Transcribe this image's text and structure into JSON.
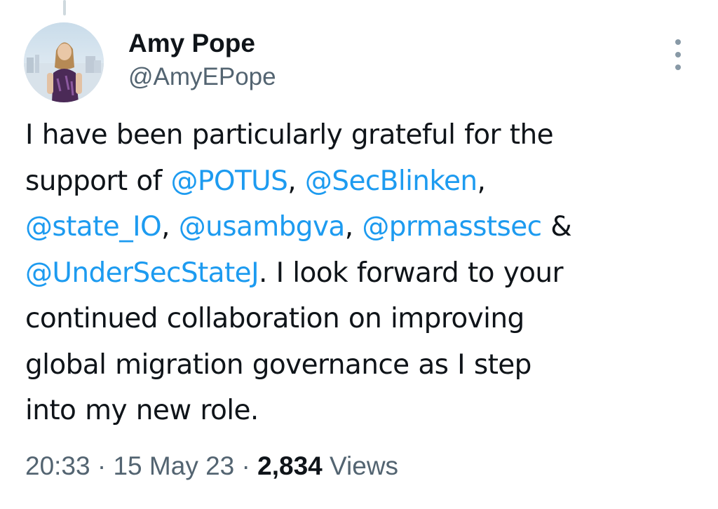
{
  "author": {
    "name": "Amy Pope",
    "handle": "@AmyEPope",
    "avatar_icon": "profile-photo"
  },
  "more_icon": "more-vertical-icon",
  "tweet": {
    "lines": [
      [
        {
          "text": "I have been particularly grateful for the",
          "type": "text"
        }
      ],
      [
        {
          "text": "support of ",
          "type": "text"
        },
        {
          "text": "@POTUS",
          "type": "mention"
        },
        {
          "text": ", ",
          "type": "text"
        },
        {
          "text": "@SecBlinken",
          "type": "mention"
        },
        {
          "text": ",",
          "type": "text"
        }
      ],
      [
        {
          "text": "@state_IO",
          "type": "mention"
        },
        {
          "text": ", ",
          "type": "text"
        },
        {
          "text": "@usambgva",
          "type": "mention"
        },
        {
          "text": ", ",
          "type": "text"
        },
        {
          "text": "@prmasstsec",
          "type": "mention"
        },
        {
          "text": " &",
          "type": "text"
        }
      ],
      [
        {
          "text": "@UnderSecStateJ",
          "type": "mention"
        },
        {
          "text": ". I look forward to your",
          "type": "text"
        }
      ],
      [
        {
          "text": "continued collaboration on improving",
          "type": "text"
        }
      ],
      [
        {
          "text": "global migration governance as I step",
          "type": "text"
        }
      ],
      [
        {
          "text": "into my new role.",
          "type": "text"
        }
      ]
    ]
  },
  "meta": {
    "time": "20:33",
    "sep1": " · ",
    "date": "15 May 23",
    "sep2": " · ",
    "views_count": "2,834",
    "views_label": " Views"
  },
  "colors": {
    "mention": "#1d9bf0",
    "secondary_text": "#536471",
    "primary_text": "#0f1419"
  }
}
